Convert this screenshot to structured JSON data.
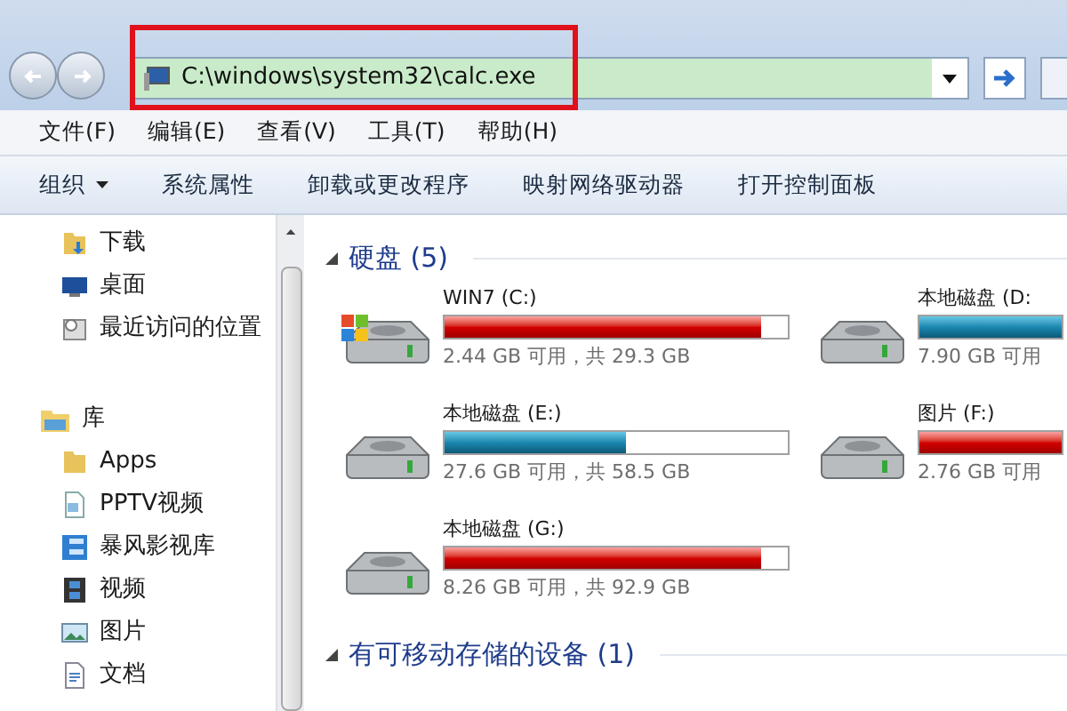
{
  "address_bar": {
    "value": "C:\\windows\\system32\\calc.exe"
  },
  "menu_bar": [
    "文件(F)",
    "编辑(E)",
    "查看(V)",
    "工具(T)",
    "帮助(H)"
  ],
  "toolbar": [
    {
      "label": "组织",
      "kind": "dropdown"
    },
    {
      "label": "系统属性",
      "kind": "button"
    },
    {
      "label": "卸载或更改程序",
      "kind": "button"
    },
    {
      "label": "映射网络驱动器",
      "kind": "button"
    },
    {
      "label": "打开控制面板",
      "kind": "button"
    }
  ],
  "sidebar": {
    "items": [
      {
        "label": "下载",
        "kind": "download"
      },
      {
        "label": "桌面",
        "kind": "desktop"
      },
      {
        "label": "最近访问的位置",
        "kind": "recent"
      },
      {
        "label": "库",
        "kind": "library",
        "children": [
          {
            "label": "Apps",
            "kind": "folder"
          },
          {
            "label": "PPTV视频",
            "kind": "file"
          },
          {
            "label": "暴风影视库",
            "kind": "film"
          },
          {
            "label": "视频",
            "kind": "video"
          },
          {
            "label": "图片",
            "kind": "picture"
          },
          {
            "label": "文档",
            "kind": "document"
          }
        ]
      }
    ]
  },
  "hard_disks": {
    "heading": "硬盘 (5)",
    "expanded": true,
    "drives": [
      {
        "name": "WIN7 (C:)",
        "system": true,
        "level": 0.92,
        "low_space": true,
        "space": "2.44 GB 可用，共 29.3 GB"
      },
      {
        "name": "本地磁盘 (D:",
        "system": false,
        "level": 1,
        "low_space": false,
        "space": "7.90 GB 可用"
      },
      {
        "name": "本地磁盘 (E:)",
        "system": false,
        "level": 0.53,
        "low_space": false,
        "space": "27.6 GB 可用，共 58.5 GB"
      },
      {
        "name": "图片 (F:)",
        "system": false,
        "level": 1,
        "low_space": true,
        "space": "2.76 GB 可用"
      },
      {
        "name": "本地磁盘 (G:)",
        "system": false,
        "level": 0.92,
        "low_space": true,
        "space": "8.26 GB 可用，共 92.9 GB"
      }
    ]
  },
  "removable": {
    "heading": "有可移动存储的设备 (1)",
    "expanded": true
  }
}
